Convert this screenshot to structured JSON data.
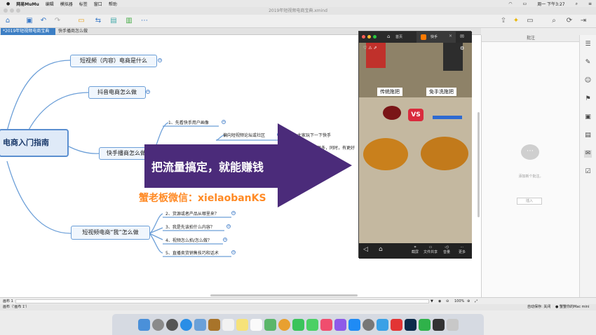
{
  "menubar": {
    "app_name": "网易MuMu",
    "items": [
      "编辑",
      "模拟器",
      "标签",
      "窗口",
      "帮助"
    ],
    "clock": "周一 下午3:27"
  },
  "window": {
    "title": "2019年短视频电商宝典.xmind"
  },
  "tabs": [
    {
      "label": "*2019年短视频电商宝典"
    },
    {
      "label": "快手播商怎么做"
    }
  ],
  "mindmap": {
    "root": "电商入门指南",
    "branches": [
      {
        "label": "短视频（内容）电商是什么"
      },
      {
        "label": "抖音电商怎么做"
      },
      {
        "label": "快手播商怎么做"
      },
      {
        "label": "短视频电商“我”怎么做"
      }
    ],
    "kuaishou_children": [
      "1、先看快手用户画像",
      "2、"
    ],
    "sub_children": [
      "偏向短视频论坛或社区",
      "大家玩下一下快手",
      "很多，同时，有更好"
    ],
    "me_children": [
      "2、货源或者产品从哪里来？",
      "3、我是先该拍什么内容？",
      "4、视频怎么拍/怎么做？",
      "5、直播卖货销售技巧和话术"
    ]
  },
  "overlay": {
    "arrow_text": "把流量搞定，就能赚钱",
    "watermark": "蟹老板微信：xielaobanKS",
    "arrow_color": "#4b2b7a"
  },
  "phone": {
    "top_tabs": [
      "首页",
      "快手"
    ],
    "video_labels": [
      "传统拖把",
      "免手洗拖把"
    ],
    "vs": "VS",
    "bottom_actions": [
      "截屏",
      "文件共享",
      "音量",
      "更多"
    ]
  },
  "right_panel": {
    "title": "批注",
    "empty_text": "添加新个批注。",
    "insert_button": "插入"
  },
  "status": {
    "sheet": "画布 1",
    "sheet_info": "画布（'画布 1'）",
    "zoom": "100%",
    "autosave": "自动保存: 关闭",
    "user": "● 蟹蟹你的Mac mini"
  },
  "colors": {
    "accent": "#3d7fc4",
    "node_border": "#6c9fd8"
  }
}
